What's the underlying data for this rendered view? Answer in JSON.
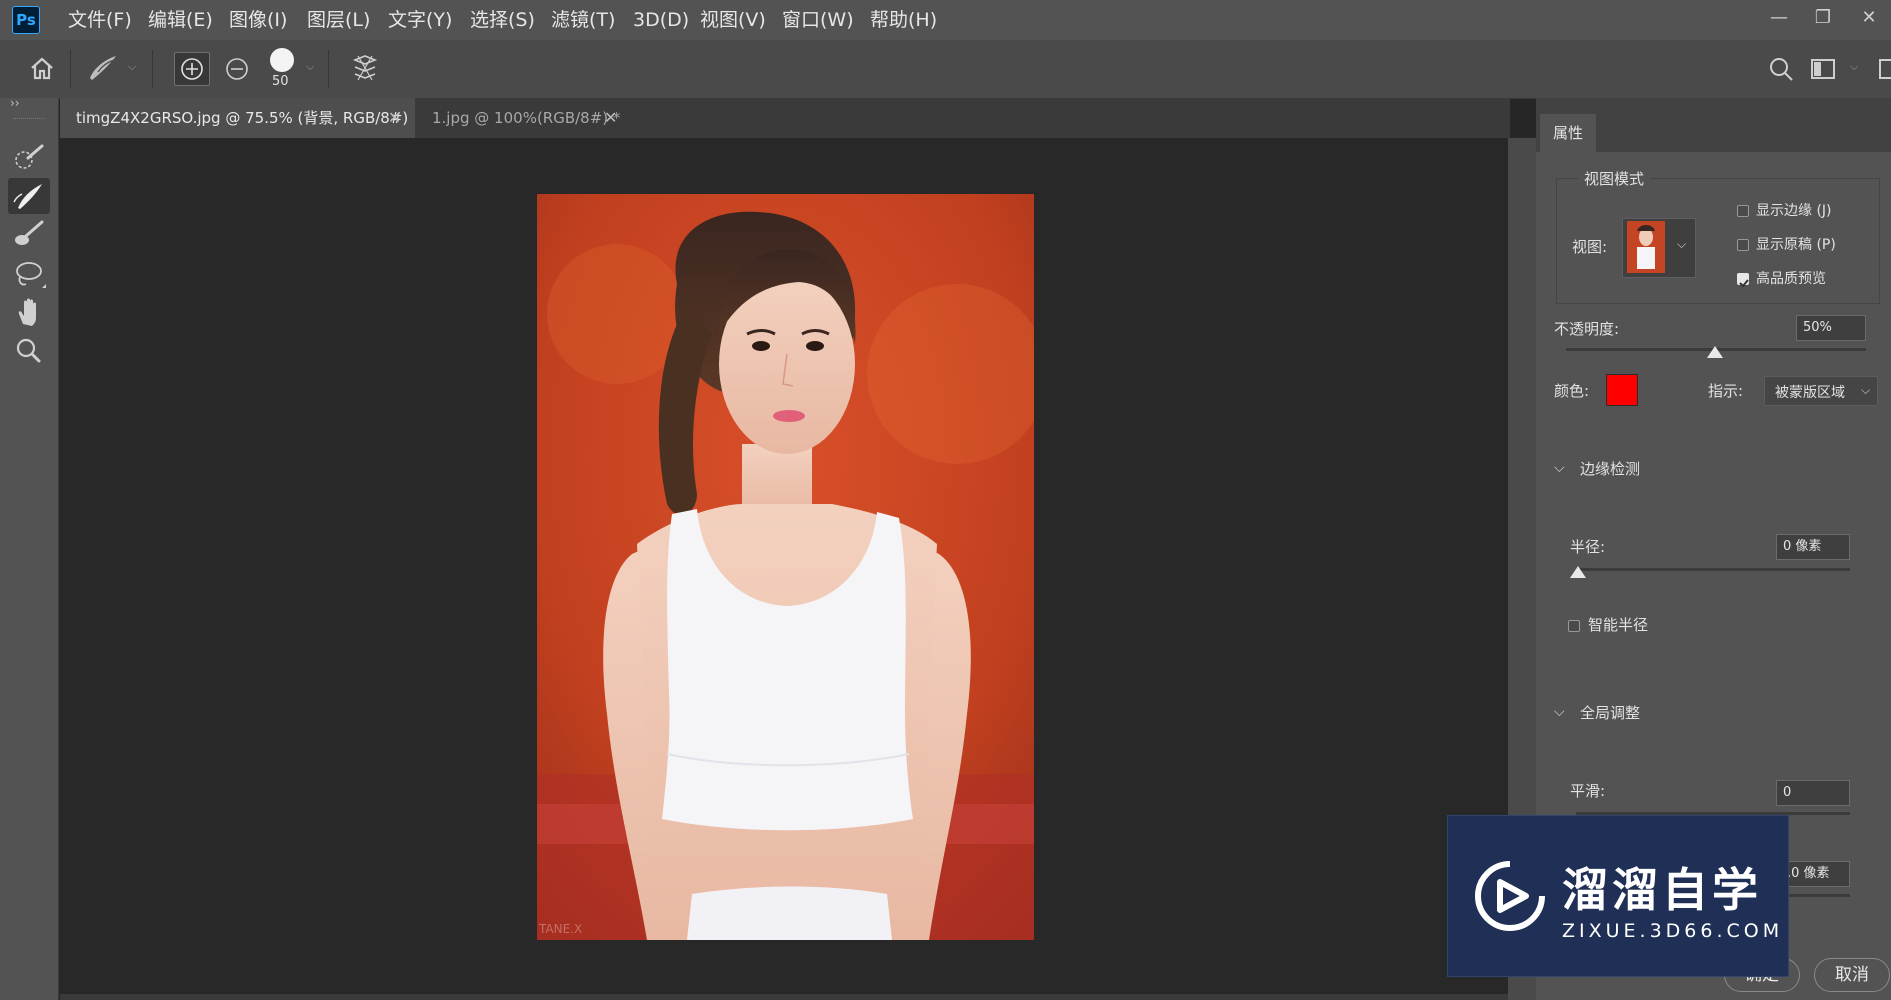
{
  "app": {
    "logo": "Ps"
  },
  "menu": [
    "文件(F)",
    "编辑(E)",
    "图像(I)",
    "图层(L)",
    "文字(Y)",
    "选择(S)",
    "滤镜(T)",
    "3D(D)",
    "视图(V)",
    "窗口(W)",
    "帮助(H)"
  ],
  "options": {
    "brush_size": "50"
  },
  "tabs": [
    {
      "label": "timgZ4X2GRSO.jpg @ 75.5% (背景, RGB/8#)",
      "active": true
    },
    {
      "label": "1.jpg @ 100%(RGB/8#) *",
      "active": false
    }
  ],
  "panel": {
    "tab": "属性",
    "view_mode": {
      "title": "视图模式",
      "view_label": "视图:",
      "checkboxes": [
        {
          "label": "显示边缘 (J)",
          "checked": false
        },
        {
          "label": "显示原稿 (P)",
          "checked": false
        },
        {
          "label": "高品质预览",
          "checked": true
        }
      ]
    },
    "opacity": {
      "label": "不透明度:",
      "value": "50%",
      "level": 0.5
    },
    "color": {
      "label": "颜色:",
      "swatch": "#ff0000"
    },
    "indicate": {
      "label": "指示:",
      "value": "被蒙版区域"
    },
    "edge_detection": {
      "title": "边缘检测",
      "radius_label": "半径:",
      "radius_value": "0 像素",
      "radius_level": 0,
      "smart_radius": "智能半径"
    },
    "global": {
      "title": "全局调整",
      "smooth_label": "平滑:",
      "smooth_value": "0",
      "feather_value": ".0 像素"
    },
    "buttons": {
      "ok": "确定",
      "cancel": "取消"
    }
  },
  "watermark": {
    "brand": "溜溜自学",
    "site": "ZIXUE.3D66.COM"
  },
  "photo_watermark": "TANE.X",
  "colors": {
    "accent": "#31a8ff",
    "panel": "#535353",
    "canvas": "#282828"
  }
}
